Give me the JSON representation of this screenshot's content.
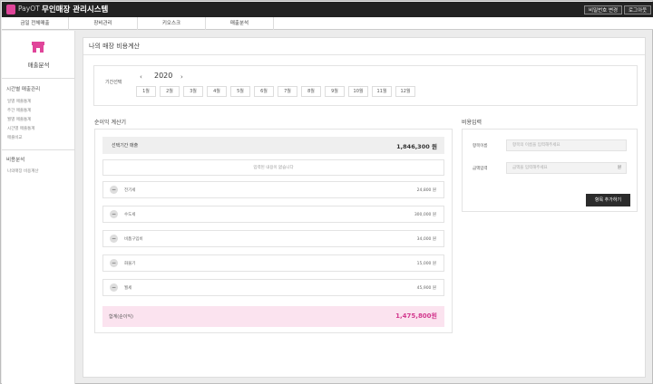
{
  "header": {
    "brand": "PayOT",
    "system_title": "무인매장 관리시스템",
    "buttons": [
      "비밀번호 변경",
      "로그아웃"
    ]
  },
  "nav": [
    "금일 전체매출",
    "장비관리",
    "키오스크",
    "매출분석"
  ],
  "sidebar": {
    "section_label": "매출분석",
    "groups": [
      {
        "title": "시간별 매출관리",
        "items": [
          "일별 매출통계",
          "주간 매출통계",
          "월별 매출통계",
          "시간별 매출통계",
          "매출비교"
        ]
      },
      {
        "title": "비용분석",
        "items": [
          "나의매장 비용계산"
        ]
      }
    ]
  },
  "page": {
    "title": "나의 매장 비용계산",
    "period": {
      "label": "기간선택",
      "year": "2020",
      "prev_icon": "chevron-left-icon",
      "next_icon": "chevron-right-icon",
      "months": [
        "1월",
        "2월",
        "3월",
        "4월",
        "5월",
        "6월",
        "7월",
        "8월",
        "9월",
        "10월",
        "11월",
        "12월"
      ]
    },
    "calculator": {
      "title": "순이익 계산기",
      "selected_label": "선택기간 매출",
      "selected_value": "1,846,300 원",
      "empty_message": "입력된 내용이 없습니다",
      "items": [
        {
          "name": "전기세",
          "value": "24,800 원"
        },
        {
          "name": "수도세",
          "value": "300,000 원"
        },
        {
          "name": "비품구입비",
          "value": "34,000 원"
        },
        {
          "name": "화물기",
          "value": "15,000 원"
        },
        {
          "name": "월세",
          "value": "45,900 원"
        }
      ],
      "total_label": "합계(순이익)",
      "total_value": "1,475,800원"
    },
    "cost_input": {
      "title": "비용입력",
      "name_label": "항목이름",
      "name_placeholder": "항목의 이름을 입력해주세요",
      "amount_label": "금액입력",
      "amount_placeholder": "금액을 입력해주세요",
      "amount_unit": "원",
      "add_button": "항목 추가하기"
    }
  },
  "colors": {
    "accent": "#d33a8f",
    "total_bg": "#fbe3ef",
    "topbar": "#222222"
  }
}
